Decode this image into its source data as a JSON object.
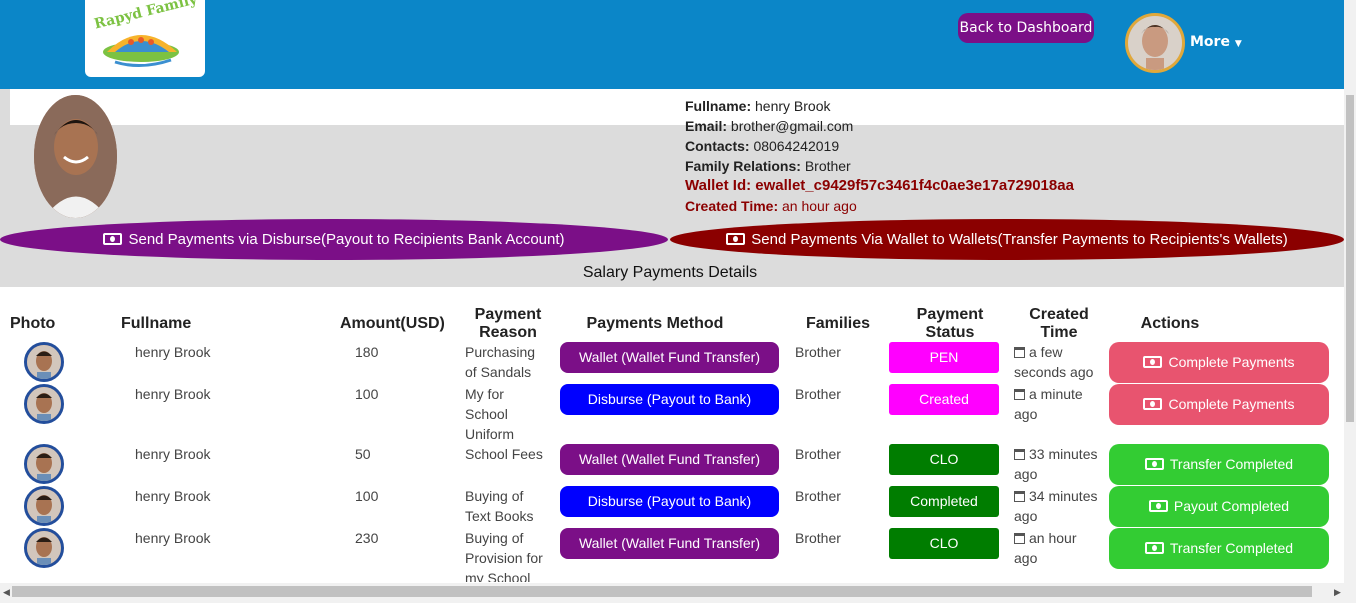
{
  "header": {
    "logo_text": "Rapyd Family",
    "back_label": "Back to Dashboard",
    "more_label": "More"
  },
  "profile": {
    "fullname_label": "Fullname:",
    "fullname": "henry Brook",
    "email_label": "Email:",
    "email": "brother@gmail.com",
    "contacts_label": "Contacts:",
    "contacts": "08064242019",
    "relations_label": "Family Relations:",
    "relations": "Brother",
    "wallet_label": "Wallet Id:",
    "wallet_id": "ewallet_c9429f57c3461f4c0ae3e17a729018aa",
    "created_label": "Created Time:",
    "created_value": "an hour ago"
  },
  "buttons": {
    "disburse": "Send Payments via Disburse(Payout to Recipients Bank Account)",
    "wallet": "Send Payments Via Wallet to Wallets(Transfer Payments to Recipients's Wallets)"
  },
  "section_title": "Salary Payments Details",
  "table": {
    "headers": {
      "photo": "Photo",
      "fullname": "Fullname",
      "amount": "Amount(USD)",
      "reason": "Payment Reason",
      "method": "Payments Method",
      "families": "Families",
      "status": "Payment Status",
      "created": "Created Time",
      "actions": "Actions"
    },
    "rows": [
      {
        "name": "henry Brook",
        "amount": "180",
        "reason": "Purchasing of Sandals",
        "method": "Wallet (Wallet Fund Transfer)",
        "family": "Brother",
        "status": "PEN",
        "created": "a few seconds ago",
        "action": "Complete Payments"
      },
      {
        "name": "henry Brook",
        "amount": "100",
        "reason": "My for School Uniform",
        "method": "Disburse (Payout to Bank)",
        "family": "Brother",
        "status": "Created",
        "created": "a minute ago",
        "action": "Complete Payments"
      },
      {
        "name": "henry Brook",
        "amount": "50",
        "reason": "School Fees",
        "method": "Wallet (Wallet Fund Transfer)",
        "family": "Brother",
        "status": "CLO",
        "created": "33 minutes ago",
        "action": "Transfer Completed"
      },
      {
        "name": "henry Brook",
        "amount": "100",
        "reason": "Buying of Text Books",
        "method": "Disburse (Payout to Bank)",
        "family": "Brother",
        "status": "Completed",
        "created": "34 minutes ago",
        "action": "Payout Completed"
      },
      {
        "name": "henry Brook",
        "amount": "230",
        "reason": "Buying of Provision for my School",
        "method": "Wallet (Wallet Fund Transfer)",
        "family": "Brother",
        "status": "CLO",
        "created": "an hour ago",
        "action": "Transfer Completed"
      }
    ]
  },
  "colors": {
    "header_bg": "#0b86c8",
    "purple": "#7b0f87",
    "dark_red": "#8b0000",
    "blue": "#0000ff",
    "magenta": "#ff00ff",
    "green_status": "#007d00",
    "pink_action": "#e8546f",
    "green_action": "#33cc33"
  }
}
